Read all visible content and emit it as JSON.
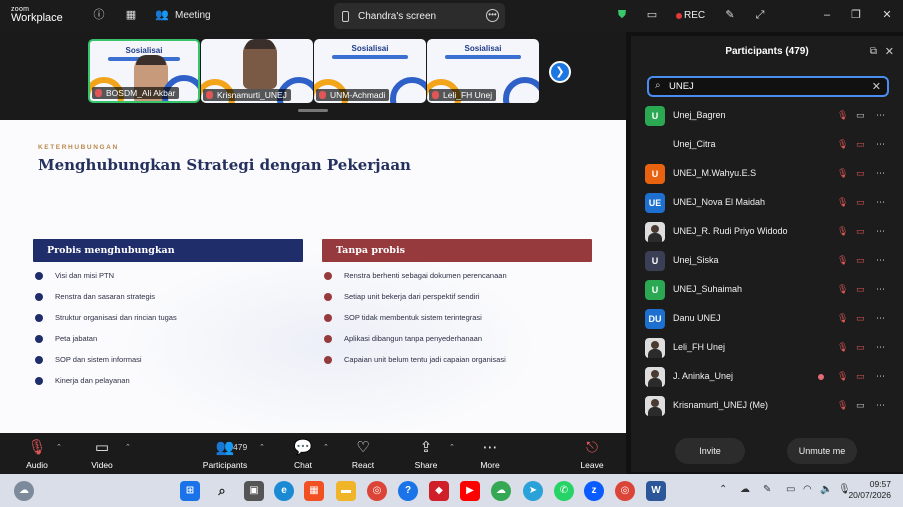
{
  "app": {
    "logo_line1": "zoom",
    "logo_line2": "Workplace"
  },
  "titlebar": {
    "meeting_label": "Meeting",
    "screen_share_label": "Chandra's screen",
    "rec_label": "REC"
  },
  "video_strip": {
    "tiles": [
      {
        "title": "Sosialisai",
        "name": "BOSDM_Ali Akbar"
      },
      {
        "title": "",
        "name": "Krisnamurti_UNEJ"
      },
      {
        "title": "Sosialisai",
        "name": "UNM-Achmadi"
      },
      {
        "title": "Sosialisai",
        "name": "Leli_FH Unej"
      }
    ]
  },
  "slide": {
    "kicker": "KETERHUBUNGAN",
    "title": "Menghubungkan Strategi dengan Pekerjaan",
    "left_heading": "Probis menghubungkan",
    "left_items": [
      "Visi dan misi PTN",
      "Renstra dan sasaran strategis",
      "Struktur organisasi dan rincian tugas",
      "Peta jabatan",
      "SOP dan sistem informasi",
      "Kinerja dan pelayanan"
    ],
    "right_heading": "Tanpa probis",
    "right_items": [
      "Renstra berhenti sebagai dokumen perencanaan",
      "Setiap unit bekerja dari perspektif sendiri",
      "SOP tidak membentuk sistem terintegrasi",
      "Aplikasi dibangun tanpa penyederhanaan",
      "Capaian unit belum tentu jadi capaian organisasi"
    ]
  },
  "controls": {
    "audio": "Audio",
    "video": "Video",
    "participants": "Participants",
    "participants_count": "479",
    "chat": "Chat",
    "react": "React",
    "share": "Share",
    "more": "More",
    "leave": "Leave"
  },
  "panel": {
    "title": "Participants (479)",
    "search_value": "UNEJ",
    "participants": [
      {
        "initials": "U",
        "color": "#2aa852",
        "name": "Unej_Bagren"
      },
      {
        "initials": "",
        "color": "",
        "name": "Unej_Citra"
      },
      {
        "initials": "U",
        "color": "#e8620f",
        "name": "UNEJ_M.Wahyu.E.S"
      },
      {
        "initials": "UE",
        "color": "#1d6fd0",
        "name": "UNEJ_Nova El Maidah"
      },
      {
        "initials": "",
        "color": "photo",
        "name": "UNEJ_R. Rudi Priyo Widodo"
      },
      {
        "initials": "U",
        "color": "#3a3f55",
        "name": "Unej_Siska"
      },
      {
        "initials": "U",
        "color": "#2aa852",
        "name": "UNEJ_Suhaimah"
      },
      {
        "initials": "DU",
        "color": "#1d6fd0",
        "name": "Danu UNEJ"
      },
      {
        "initials": "",
        "color": "photo",
        "name": "Leli_FH Unej"
      },
      {
        "initials": "",
        "color": "photo",
        "name": "J. Aninka_Unej"
      },
      {
        "initials": "",
        "color": "photo",
        "name": "Krisnamurti_UNEJ (Me)"
      }
    ],
    "invite_label": "Invite",
    "unmute_label": "Unmute me"
  },
  "taskbar": {
    "time": "09:57",
    "date": "20/07/2026"
  }
}
